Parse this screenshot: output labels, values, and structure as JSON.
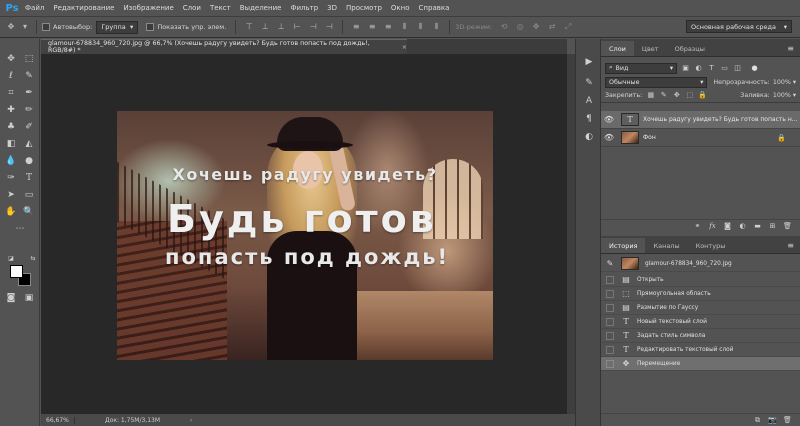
{
  "app": {
    "logo": "Ps",
    "accent": "#2fa3f5"
  },
  "menu": [
    "Файл",
    "Редактирование",
    "Изображение",
    "Слои",
    "Текст",
    "Выделение",
    "Фильтр",
    "3D",
    "Просмотр",
    "Окно",
    "Справка"
  ],
  "options": {
    "autoselect_label": "Автовыбор:",
    "autoselect_value": "Группа",
    "show_controls_label": "Показать упр. элем.",
    "mode_3d_label": "3D-режим:",
    "workspace": "Основная рабочая среда"
  },
  "document": {
    "tab_title": "glamour-678834_960_720.jpg @ 66,7% (Хочешь радугу увидеть?  Будь готов  попасть под дождь!, RGB/8#) *",
    "close": "×",
    "zoom": "66,67%",
    "doc_size": "Док: 1,75М/3,13М",
    "status_arrow": "›"
  },
  "canvas_text": {
    "line1": "Хочешь радугу увидеть?",
    "line2": "Будь готов",
    "line3": "попасть под дождь!"
  },
  "layers_panel": {
    "tabs": [
      "Слои",
      "Цвет",
      "Образцы"
    ],
    "active_tab": 0,
    "kind_filter": "Вид",
    "blend_mode": "Обычные",
    "opacity_label": "Непрозрачность:",
    "opacity_value": "100%",
    "lock_label": "Закрепить:",
    "fill_label": "Заливка:",
    "fill_value": "100%",
    "layers": [
      {
        "name": "Хочешь радугу увидеть?  Будь готов  попасть н...",
        "kind": "text",
        "thumb": "T",
        "selected": true
      },
      {
        "name": "Фон",
        "kind": "image",
        "locked": true,
        "selected": false
      }
    ]
  },
  "history_panel": {
    "tabs": [
      "История",
      "Каналы",
      "Контуры"
    ],
    "active_tab": 0,
    "snapshot": "glamour-678834_960_720.jpg",
    "items": [
      {
        "label": "Открыть",
        "icon": "open-icon"
      },
      {
        "label": "Прямоугольная область",
        "icon": "marquee-icon"
      },
      {
        "label": "Размытие по Гауссу",
        "icon": "filter-icon"
      },
      {
        "label": "Новый текстовый слой",
        "icon": "text-icon"
      },
      {
        "label": "Задать стиль символа",
        "icon": "text-icon"
      },
      {
        "label": "Редактировать текстовый слой",
        "icon": "text-icon"
      },
      {
        "label": "Перемещение",
        "icon": "move-icon",
        "selected": true
      }
    ]
  },
  "colors": {
    "foreground": "#ffffff",
    "background": "#000000",
    "ui_bg": "#535353",
    "canvas_bg": "#282828"
  }
}
